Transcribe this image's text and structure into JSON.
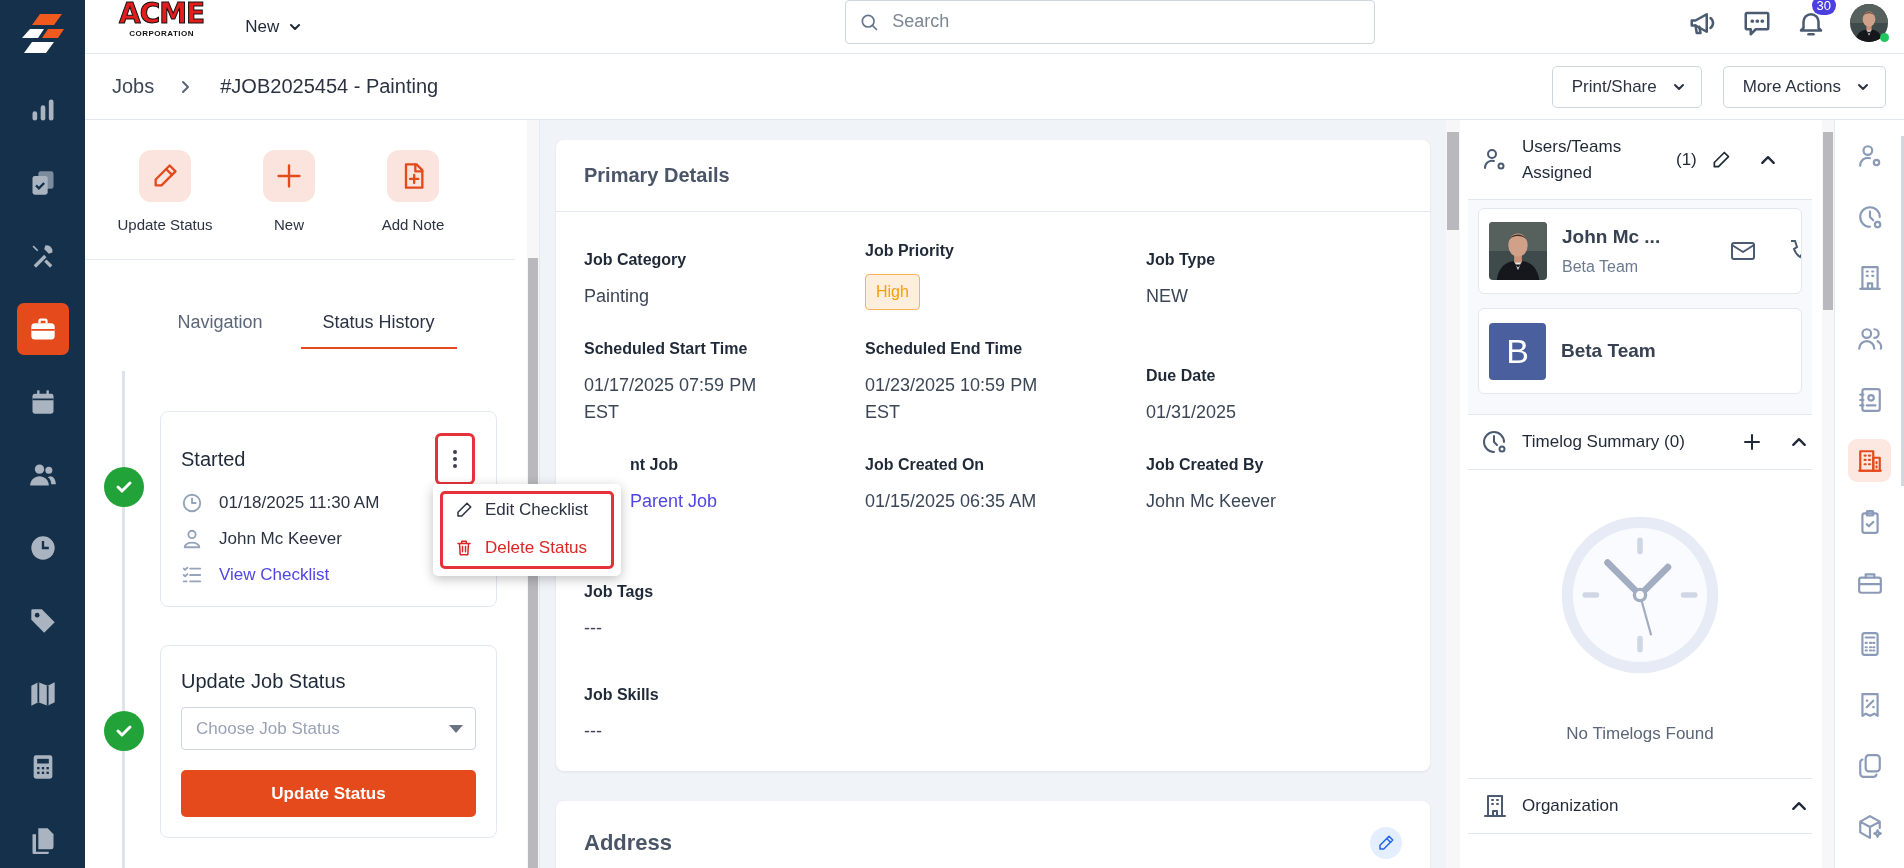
{
  "nav": {
    "items": [
      {
        "selected": false
      },
      {
        "selected": false
      },
      {
        "selected": false
      },
      {
        "selected": true
      },
      {
        "selected": false
      },
      {
        "selected": false
      },
      {
        "selected": false
      },
      {
        "selected": false
      },
      {
        "selected": false
      },
      {
        "selected": false
      },
      {
        "selected": false
      }
    ]
  },
  "top_bar": {
    "logo": {
      "word": "ACME",
      "sub": "CORPORATION"
    },
    "new_menu": "New",
    "search": {
      "placeholder": "Search"
    },
    "notification_count": "30",
    "user_online": true
  },
  "breadcrumb": [
    "Jobs",
    "#JOB2025454 - Painting"
  ],
  "header_buttons": [
    "Print/Share",
    "More Actions"
  ],
  "quick_actions": [
    {
      "label": "Update Status"
    },
    {
      "label": "New"
    },
    {
      "label": "Add Note"
    }
  ],
  "tabs": [
    {
      "label": "Navigation",
      "selected": false
    },
    {
      "label": "Status History",
      "selected": true
    }
  ],
  "status_history": [
    {
      "kind": "status",
      "done": true,
      "title": "Started",
      "time": "01/18/2025 11:30 AM",
      "user": "John Mc Keever",
      "link": "View Checklist",
      "menu_open": true,
      "highlighted": true,
      "menu": [
        {
          "label": "Edit Checklist",
          "kind": "edit"
        },
        {
          "label": "Delete Status",
          "kind": "delete"
        }
      ]
    },
    {
      "kind": "update",
      "done": true,
      "title": "Update Job Status",
      "select": {
        "placeholder": "Choose Job Status"
      },
      "button": "Update Status"
    }
  ],
  "primary_details": {
    "title": "Primary Details",
    "rows": [
      [
        {
          "label": "Job Category",
          "value": "Painting",
          "kind": "text"
        },
        {
          "label": "Job Priority",
          "value": "High",
          "kind": "badge"
        },
        {
          "label": "Job Type",
          "value": "NEW",
          "kind": "text"
        }
      ],
      [
        {
          "label": "Scheduled Start Time",
          "value": "01/17/2025 07:59 PM EST",
          "kind": "text"
        },
        {
          "label": "Scheduled End Time",
          "value": "01/23/2025 10:59 PM EST",
          "kind": "text"
        },
        {
          "label": "Due Date",
          "value": "01/31/2025",
          "kind": "text"
        }
      ],
      [
        {
          "label": "nt Job",
          "value": "Parent Job",
          "kind": "link"
        },
        {
          "label": "Job Created On",
          "value": "01/15/2025 06:35 AM",
          "kind": "text"
        },
        {
          "label": "Job Created By",
          "value": "John Mc Keever",
          "kind": "text"
        }
      ],
      [
        {
          "label": "Job Tags",
          "value": "---",
          "kind": "text"
        }
      ],
      [
        {
          "label": "Job Skills",
          "value": "---",
          "kind": "text"
        }
      ]
    ]
  },
  "address": {
    "title": "Address"
  },
  "assigned": {
    "title": "Users/Teams Assigned",
    "count": "(1)",
    "expanded": true,
    "members": [
      {
        "kind": "user",
        "name": "John Mc ...",
        "team": "Beta Team"
      },
      {
        "kind": "team",
        "initial": "B",
        "name": "Beta Team"
      }
    ]
  },
  "timelog": {
    "title": "Timelog Summary (0)",
    "expanded": true,
    "empty_text": "No Timelogs Found"
  },
  "organization": {
    "title": "Organization",
    "expanded": true
  },
  "rail": {
    "items": [
      {
        "selected": false
      },
      {
        "selected": false
      },
      {
        "selected": false
      },
      {
        "selected": false
      },
      {
        "selected": false
      },
      {
        "selected": true
      },
      {
        "selected": false
      },
      {
        "selected": false
      },
      {
        "selected": false
      },
      {
        "selected": false
      },
      {
        "selected": false
      },
      {
        "selected": false
      }
    ]
  }
}
